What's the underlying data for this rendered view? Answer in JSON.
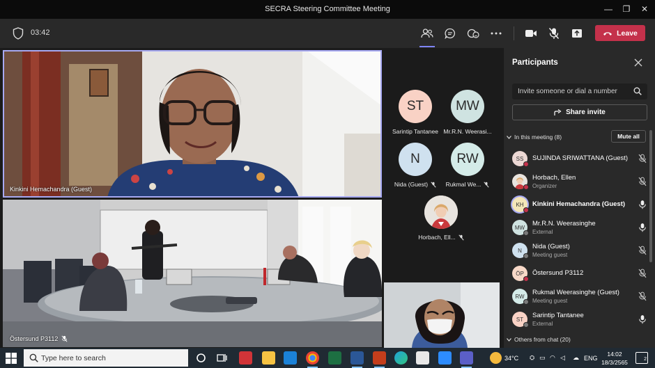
{
  "window": {
    "title": "SECRA Steering Committee Meeting",
    "minimize": "—",
    "restore": "❐",
    "close": "✕"
  },
  "toolbar": {
    "timer": "03:42",
    "leave_label": "Leave"
  },
  "stage": {
    "tiles": [
      {
        "label": "Kinkini Hemachandra (Guest)"
      },
      {
        "label": "Östersund P3112"
      }
    ],
    "avatars": [
      {
        "initials": "ST",
        "name": "Sarintip Tantanee",
        "color": "#f9d2c5"
      },
      {
        "initials": "MW",
        "name": "Mr.R.N. Weerasi...",
        "color": "#cfe3e1"
      },
      {
        "initials": "N",
        "name": "Nida (Guest)",
        "color": "#cfe1ef"
      },
      {
        "initials": "RW",
        "name": "Rukmal We...",
        "color": "#d4ebe8"
      },
      {
        "initials": "",
        "name": "Horbach, Ell..."
      }
    ]
  },
  "panel": {
    "title": "Participants",
    "invite_placeholder": "Invite someone or dial a number",
    "share_label": "Share invite",
    "in_meeting": "In this meeting (8)",
    "mute_all": "Mute all",
    "others": "Others from chat (20)",
    "participants": [
      {
        "initials": "SS",
        "name": "SUJINDA SRIWATTANA (Guest)",
        "sub": "",
        "color": "#ecd8d4",
        "dot": "#c4314b",
        "bold": false
      },
      {
        "initials": "",
        "name": "Horbach, Ellen",
        "sub": "Organizer",
        "color": "#c99a7a",
        "dot": "#c4314b",
        "bold": false
      },
      {
        "initials": "KH",
        "name": "Kinkini Hemachandra (Guest)",
        "sub": "",
        "color": "#f4e6b8",
        "dot": "#c4314b",
        "bold": true
      },
      {
        "initials": "MW",
        "name": "Mr.R.N. Weerasinghe",
        "sub": "External",
        "color": "#cfe3e1",
        "dot": "#7a7a7a",
        "bold": false
      },
      {
        "initials": "N",
        "name": "Nida (Guest)",
        "sub": "Meeting guest",
        "color": "#cfe1ef",
        "dot": "#7a7a7a",
        "bold": false
      },
      {
        "initials": "ÖP",
        "name": "Östersund P3112",
        "sub": "",
        "color": "#f8d9c8",
        "dot": "#c4314b",
        "bold": false
      },
      {
        "initials": "RW",
        "name": "Rukmal Weerasinghe (Guest)",
        "sub": "Meeting guest",
        "color": "#d4ebe8",
        "dot": "#7a7a7a",
        "bold": false
      },
      {
        "initials": "ST",
        "name": "Sarintip Tantanee",
        "sub": "External",
        "color": "#f9d2c5",
        "dot": "#7a7a7a",
        "bold": false
      }
    ]
  },
  "taskbar": {
    "search_placeholder": "Type here to search",
    "temperature": "34°C",
    "language": "ENG",
    "time": "14:02",
    "date": "18/3/2565",
    "notifications": "2"
  }
}
